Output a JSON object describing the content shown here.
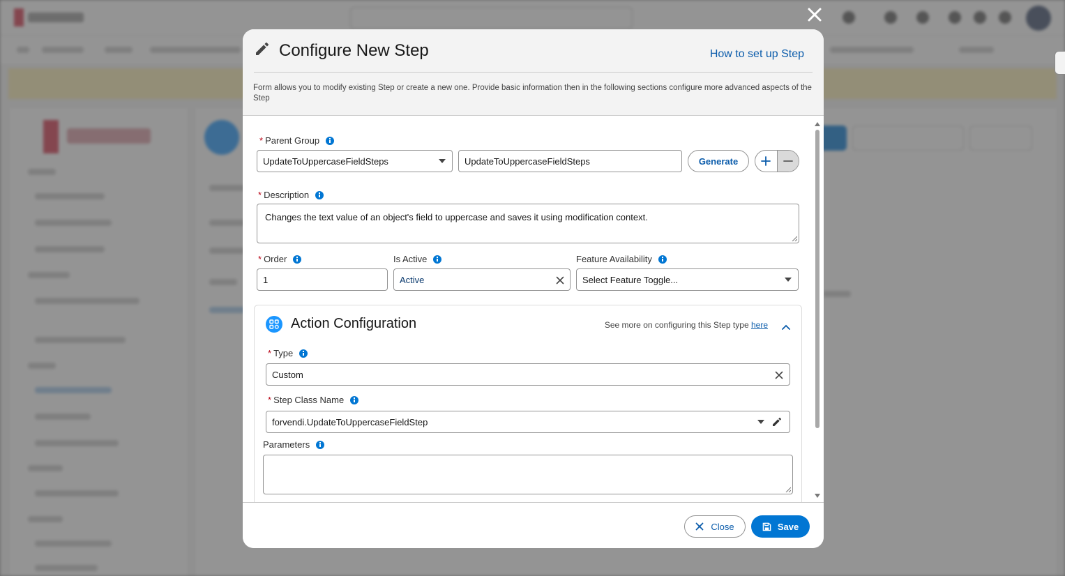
{
  "dialog": {
    "title": "Configure New Step",
    "help_link": "How to set up Step",
    "description": "Form allows you to modify existing Step or create a new one. Provide basic information then in the following sections configure more advanced aspects of the Step"
  },
  "form": {
    "parent_group": {
      "label": "Parent Group",
      "required_mark": "*",
      "selected": "UpdateToUppercaseFieldSteps",
      "text_value": "UpdateToUppercaseFieldSteps",
      "generate_label": "Generate"
    },
    "description": {
      "label": "Description",
      "required_mark": "*",
      "value": "Changes the text value of an object's field to uppercase and saves it using modification context."
    },
    "order": {
      "label": "Order",
      "required_mark": "*",
      "value": "1"
    },
    "is_active": {
      "label": "Is Active",
      "value": "Active"
    },
    "feature_availability": {
      "label": "Feature Availability",
      "placeholder": "Select Feature Toggle..."
    }
  },
  "action_configuration": {
    "title": "Action Configuration",
    "more_text": "See more on configuring this Step type",
    "more_link": "here",
    "type": {
      "label": "Type",
      "required_mark": "*",
      "value": "Custom"
    },
    "step_class_name": {
      "label": "Step Class Name",
      "required_mark": "*",
      "value": "forvendi.UpdateToUppercaseFieldStep"
    },
    "parameters": {
      "label": "Parameters",
      "value": ""
    }
  },
  "footer": {
    "close_label": "Close",
    "save_label": "Save"
  },
  "colors": {
    "brand_blue": "#0176d3",
    "link_blue": "#0b5cab",
    "required_red": "#ba0517"
  }
}
